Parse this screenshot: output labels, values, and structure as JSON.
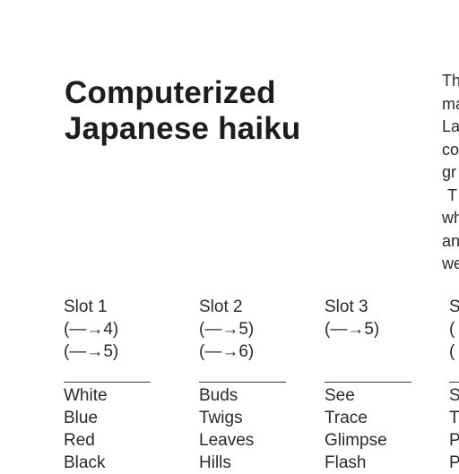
{
  "title": {
    "line1": "Computerized",
    "line2": "Japanese haiku"
  },
  "side_text": [
    "Th",
    "ma",
    "La",
    "co",
    "gr",
    "T",
    "wh",
    "an",
    "we"
  ],
  "slots": [
    {
      "label": "Slot 1",
      "arrows": [
        "(—→4)",
        "(—→5)"
      ],
      "words": [
        "White",
        "Blue",
        "Red",
        "Black"
      ]
    },
    {
      "label": "Slot 2",
      "arrows": [
        "(—→5)",
        "(—→6)"
      ],
      "words": [
        "Buds",
        "Twigs",
        "Leaves",
        "Hills"
      ]
    },
    {
      "label": "Slot 3",
      "arrows": [
        "(—→5)",
        ""
      ],
      "words": [
        "See",
        "Trace",
        "Glimpse",
        "Flash"
      ]
    },
    {
      "label": "S",
      "arrows": [
        "(",
        "("
      ],
      "words": [
        "S",
        "T",
        "P",
        "P"
      ]
    }
  ]
}
